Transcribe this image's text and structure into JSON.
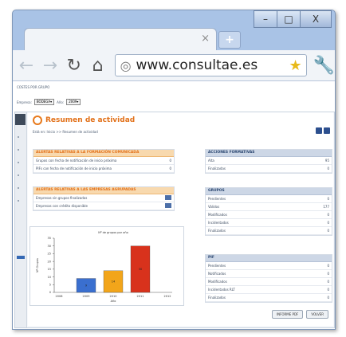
{
  "browser": {
    "tab_close": "×",
    "new_tab": "+",
    "url": "www.consultae.es",
    "win_min": "–",
    "win_max": "□",
    "win_close": "X"
  },
  "page": {
    "section": "COSTES POR GRUPO",
    "filter_label1": "Empresa:",
    "filter_value1": "BODEGA▾",
    "filter_label2": "Año:",
    "filter_value2": "2009▾",
    "title": "Resumen de actividad",
    "breadcrumb": "Está en: Inicio >> Resumen de actividad"
  },
  "panels": {
    "alertas_formacion": {
      "title": "ALERTAS RELATIVAS A LA FORMACIÓN COMUNICADA",
      "rows": [
        {
          "label": "Grupos con fecha de notificación de inicio próxima",
          "value": "0"
        },
        {
          "label": "PIFs con fecha de notificación de inicio próxima",
          "value": "0"
        }
      ]
    },
    "alertas_empresas": {
      "title": "ALERTAS RELATIVAS A LAS EMPRESAS AGRUPADAS",
      "rows": [
        {
          "label": "Empresas sin grupos finalizados"
        },
        {
          "label": "Empresas con crédito disponible"
        }
      ]
    },
    "acciones": {
      "title": "ACCIONES FORMATIVAS",
      "rows": [
        {
          "label": "Alta",
          "value": "95"
        },
        {
          "label": "Finalizadas",
          "value": "0"
        }
      ]
    },
    "grupos": {
      "title": "GRUPOS",
      "rows": [
        {
          "label": "Pendientes",
          "value": "0"
        },
        {
          "label": "Válidos",
          "value": "177"
        },
        {
          "label": "Modificados",
          "value": "0"
        },
        {
          "label": "Incidentados",
          "value": "0"
        },
        {
          "label": "Finalizados",
          "value": "0"
        }
      ]
    },
    "pif": {
      "title": "PIF",
      "rows": [
        {
          "label": "Pendientes",
          "value": "0"
        },
        {
          "label": "Notificados",
          "value": "0"
        },
        {
          "label": "Modificados",
          "value": "0"
        },
        {
          "label": "Incidentados RLT",
          "value": "0"
        },
        {
          "label": "Finalizados",
          "value": "0"
        }
      ]
    }
  },
  "buttons": {
    "informe": "INFORME PDF",
    "volver": "VOLVER"
  },
  "chart_data": {
    "type": "bar",
    "title": "Nº de grupos por año",
    "xlabel": "Año",
    "ylabel": "Nº Grupos",
    "categories": [
      "2009",
      "2010",
      "2011"
    ],
    "values": [
      9,
      14,
      30
    ],
    "colors": [
      "#3a6fcf",
      "#f2a51a",
      "#d8321c"
    ],
    "x_ticks": [
      "2008",
      "2009",
      "2010",
      "2011",
      "2012"
    ],
    "ylim": [
      0,
      35
    ],
    "y_ticks": [
      0,
      5,
      10,
      15,
      20,
      25,
      30,
      35
    ]
  }
}
